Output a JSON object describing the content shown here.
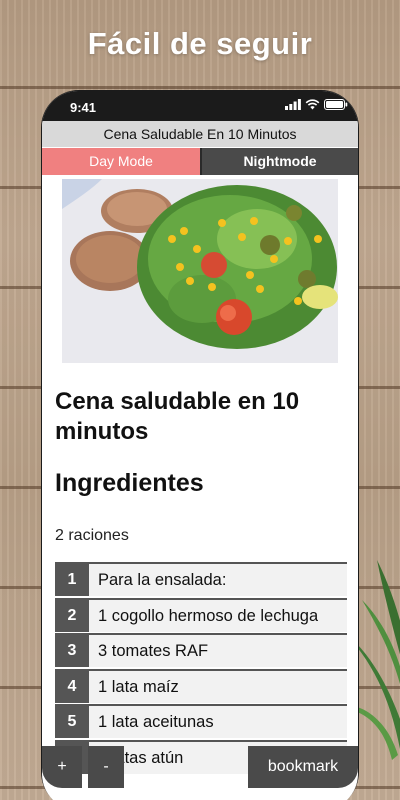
{
  "headline": "Fácil de seguir",
  "status": {
    "time": "9:41"
  },
  "app": {
    "title": "Cena Saludable En 10 Minutos",
    "day_mode_label": "Day Mode",
    "night_mode_label": "Nightmode"
  },
  "recipe": {
    "title": "Cena saludable en 10 minutos",
    "ingredients_heading": "Ingredientes",
    "servings": "2 raciones",
    "ingredients": [
      {
        "num": "1",
        "text": "Para la ensalada:"
      },
      {
        "num": "2",
        "text": "1 cogollo hermoso de lechuga"
      },
      {
        "num": "3",
        "text": "3 tomates RAF"
      },
      {
        "num": "4",
        "text": "1 lata maíz"
      },
      {
        "num": "5",
        "text": "1 lata aceitunas"
      },
      {
        "num": "6",
        "text": "2 latas atún"
      }
    ]
  },
  "controls": {
    "plus_label": "+",
    "minus_label": "-",
    "bookmark_label": "bookmark"
  },
  "colors": {
    "day_mode_bg": "#f08080",
    "night_mode_bg": "#4a4a4a",
    "number_badge": "#555555"
  }
}
